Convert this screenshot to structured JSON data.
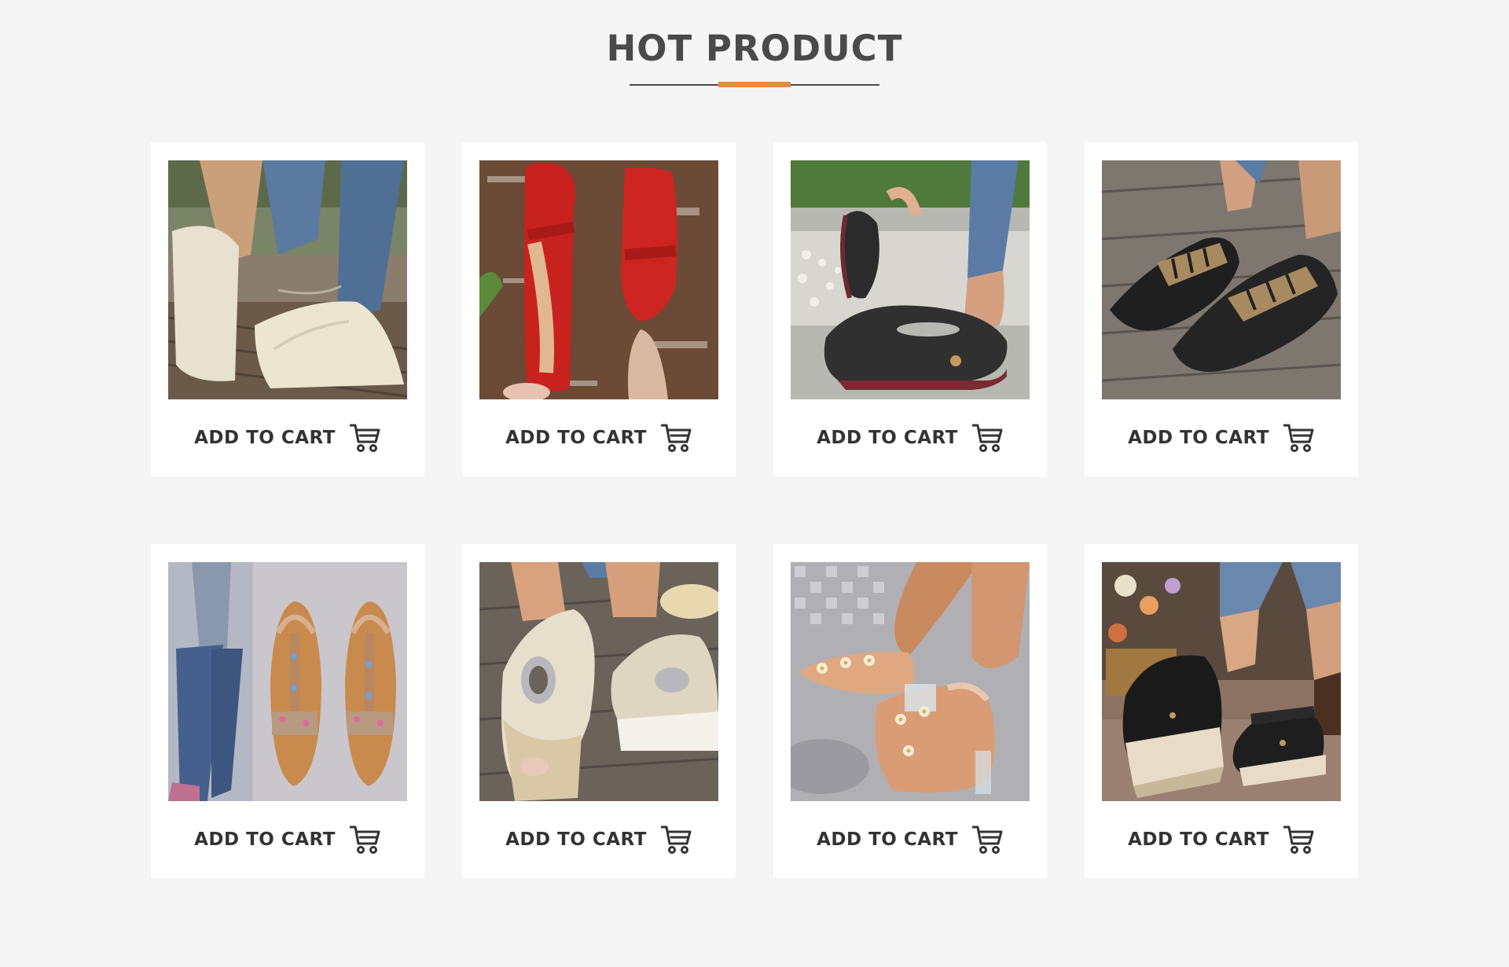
{
  "section": {
    "title": "HOT PRODUCT",
    "accent_color": "#e58a4a",
    "title_color": "#4a4a4a"
  },
  "products": [
    {
      "image": "cream-knit-loafer-on-deck",
      "cta": "ADD TO CART",
      "cart_icon": "shopping-cart-icon"
    },
    {
      "image": "red-knit-mary-jane-flats",
      "cta": "ADD TO CART",
      "cart_icon": "shopping-cart-icon"
    },
    {
      "image": "black-cutout-flat-shoe",
      "cta": "ADD TO CART",
      "cart_icon": "shopping-cart-icon"
    },
    {
      "image": "black-zebra-strap-flats",
      "cta": "ADD TO CART",
      "cart_icon": "shopping-cart-icon"
    },
    {
      "image": "jeweled-t-strap-sandals",
      "cta": "ADD TO CART",
      "cart_icon": "shopping-cart-icon"
    },
    {
      "image": "silver-wedge-sandals",
      "cta": "ADD TO CART",
      "cart_icon": "shopping-cart-icon"
    },
    {
      "image": "floral-clear-heel-sandals",
      "cta": "ADD TO CART",
      "cart_icon": "shopping-cart-icon"
    },
    {
      "image": "black-espadrille-wedges",
      "cta": "ADD TO CART",
      "cart_icon": "shopping-cart-icon"
    }
  ]
}
